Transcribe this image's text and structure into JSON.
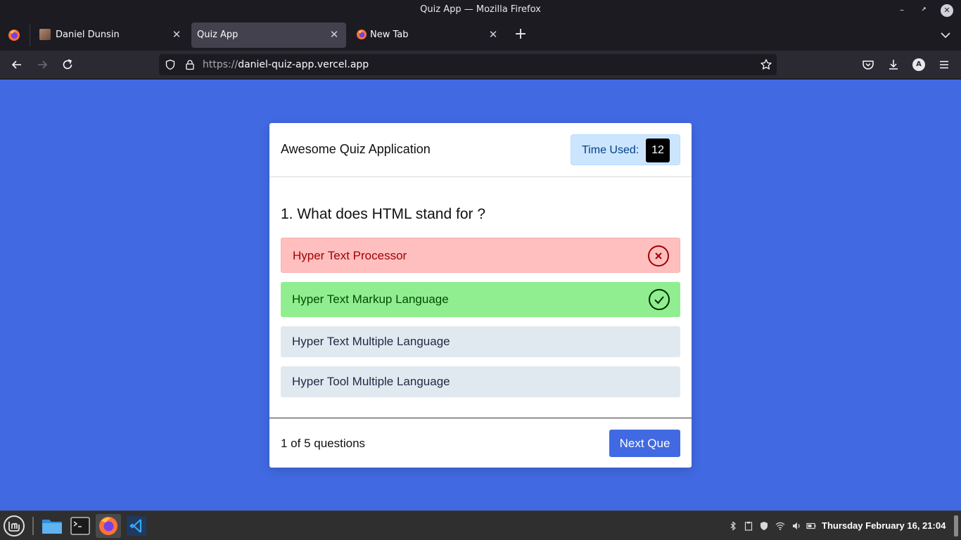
{
  "window": {
    "title": "Quiz App — Mozilla Firefox"
  },
  "tabs": [
    {
      "label": "Daniel Dunsin",
      "active": false
    },
    {
      "label": "Quiz App",
      "active": true
    },
    {
      "label": "New Tab",
      "active": false
    }
  ],
  "navbar": {
    "url_scheme": "https://",
    "url_host": "daniel-quiz-app.vercel.app",
    "account_initial": "A"
  },
  "quiz": {
    "app_title": "Awesome Quiz Application",
    "timer_label": "Time Used:",
    "timer_value": "12",
    "question": "1. What does HTML stand for ?",
    "options": [
      {
        "text": "Hyper Text Processor",
        "state": "incorrect"
      },
      {
        "text": "Hyper Text Markup Language",
        "state": "correct"
      },
      {
        "text": "Hyper Text Multiple Language",
        "state": "neutral"
      },
      {
        "text": "Hyper Tool Multiple Language",
        "state": "neutral"
      }
    ],
    "progress_text": "1 of 5 questions",
    "next_button": "Next Que"
  },
  "taskbar": {
    "clock": "Thursday February 16, 21:04"
  },
  "colors": {
    "page_background": "#4169e1",
    "incorrect_bg": "#ffbfbf",
    "correct_bg": "#90ee90",
    "neutral_bg": "#e1e9f0",
    "accent": "#4169e1"
  }
}
